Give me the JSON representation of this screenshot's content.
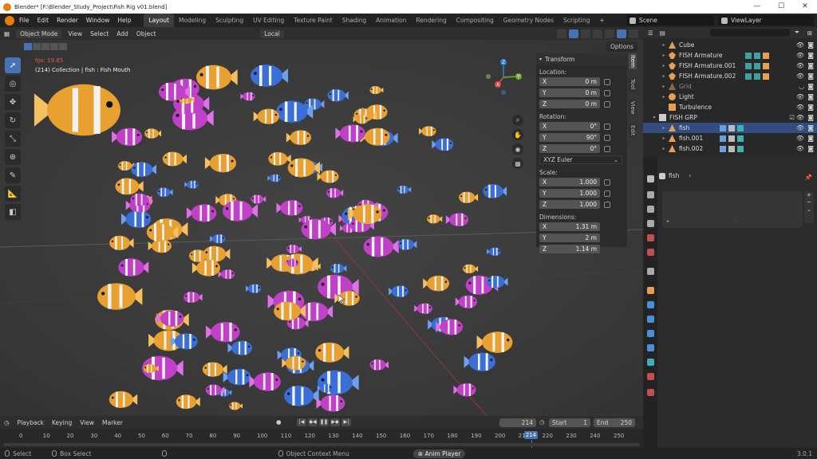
{
  "window": {
    "title": "Blender* [F:\\Blender_Study_Project\\Fish Rig v01.blend]",
    "controls": [
      "—",
      "☐",
      "✕"
    ]
  },
  "menu": [
    "File",
    "Edit",
    "Render",
    "Window",
    "Help"
  ],
  "workspaces": [
    "Layout",
    "Modeling",
    "Sculpting",
    "UV Editing",
    "Texture Paint",
    "Shading",
    "Animation",
    "Rendering",
    "Compositing",
    "Geometry Nodes",
    "Scripting"
  ],
  "workspace_plus": "+",
  "scene": {
    "label": "Scene",
    "view_layer": "ViewLayer"
  },
  "viewport_header": {
    "mode": "Object Mode",
    "items": [
      "View",
      "Select",
      "Add",
      "Object"
    ],
    "orientation": "Local"
  },
  "viewport": {
    "fps": "fps: 19.85",
    "collection": "(214) Collection | fish : Fish Mouth",
    "options": "Options",
    "gizmo_axes": [
      "X",
      "Y",
      "Z"
    ]
  },
  "npanel": {
    "header": "Transform",
    "location_label": "Location:",
    "location": [
      {
        "axis": "X",
        "value": "0 m"
      },
      {
        "axis": "Y",
        "value": "0 m"
      },
      {
        "axis": "Z",
        "value": "0 m"
      }
    ],
    "rotation_label": "Rotation:",
    "rotation": [
      {
        "axis": "X",
        "value": "0°"
      },
      {
        "axis": "Y",
        "value": "90°"
      },
      {
        "axis": "Z",
        "value": "0°"
      }
    ],
    "rotation_mode": "XYZ Euler",
    "scale_label": "Scale:",
    "scale": [
      {
        "axis": "X",
        "value": "1.000"
      },
      {
        "axis": "Y",
        "value": "1.000"
      },
      {
        "axis": "Z",
        "value": "1.000"
      }
    ],
    "dimensions_label": "Dimensions:",
    "dimensions": [
      {
        "axis": "X",
        "value": "1.31 m"
      },
      {
        "axis": "Y",
        "value": "2 m"
      },
      {
        "axis": "Z",
        "value": "1.14 m"
      }
    ],
    "tabs": [
      "Item",
      "Tool",
      "View",
      "Edit"
    ]
  },
  "outliner": {
    "rows": [
      {
        "name": "Cube",
        "icon_color": "#e8a050"
      },
      {
        "name": "FISH Armature",
        "icon_color": "#e8a050"
      },
      {
        "name": "FISH Armature.001",
        "icon_color": "#e8a050"
      },
      {
        "name": "FISH Armature.002",
        "icon_color": "#e8a050"
      },
      {
        "name": "Grid",
        "icon_color": "#e8a050"
      },
      {
        "name": "Light",
        "icon_color": "#e8a050"
      },
      {
        "name": "Turbulence",
        "icon_color": "#e8a050"
      },
      {
        "name": "FISH GRP",
        "icon_color": "#cccccc"
      },
      {
        "name": "fish",
        "icon_color": "#e8a050"
      },
      {
        "name": "fish.001",
        "icon_color": "#e8a050"
      },
      {
        "name": "fish.002",
        "icon_color": "#e8a050"
      }
    ]
  },
  "properties": {
    "object_name": "fish"
  },
  "timeline": {
    "items": [
      "Playback",
      "Keying",
      "View",
      "Marker"
    ],
    "current_frame": "214",
    "start_label": "Start",
    "start": "1",
    "end_label": "End",
    "end": "250",
    "ticks": [
      "0",
      "10",
      "20",
      "30",
      "40",
      "50",
      "60",
      "70",
      "80",
      "90",
      "100",
      "110",
      "120",
      "130",
      "140",
      "150",
      "160",
      "170",
      "180",
      "190",
      "200",
      "210",
      "220",
      "230",
      "240",
      "250"
    ]
  },
  "statusbar": {
    "select": "Select",
    "box_select": "Box Select",
    "context_menu": "Object Context Menu",
    "anim_player": "Anim Player",
    "version": "3.0.1"
  },
  "colors": {
    "accent": "#4772b3",
    "orange": "#e8a050",
    "selected_row": "#334d80"
  }
}
